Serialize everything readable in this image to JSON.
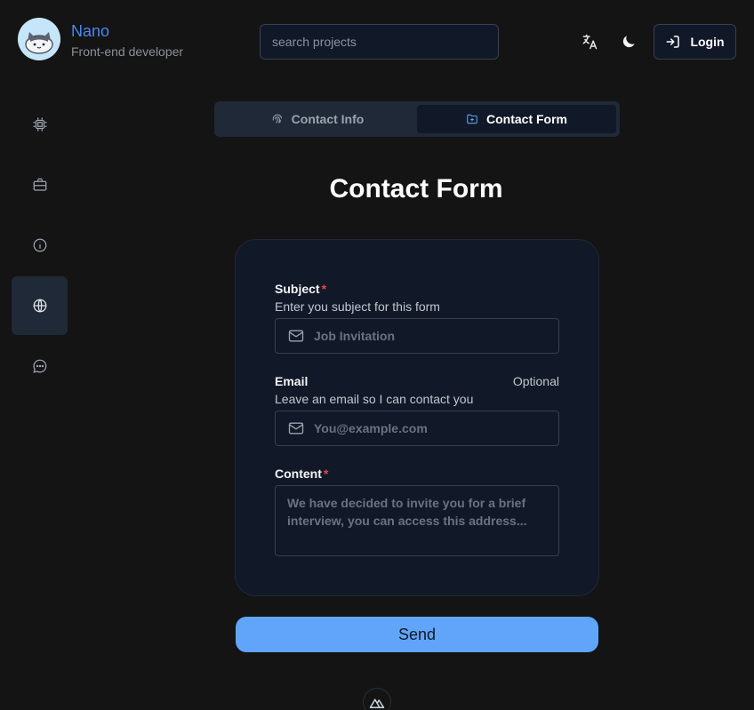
{
  "profile": {
    "name": "Nano",
    "role": "Front-end developer"
  },
  "search": {
    "placeholder": "search projects",
    "value": ""
  },
  "header": {
    "login_label": "Login"
  },
  "sidebar": {
    "items": [
      {
        "icon": "cpu-icon",
        "active": false
      },
      {
        "icon": "briefcase-icon",
        "active": false
      },
      {
        "icon": "info-icon",
        "active": false
      },
      {
        "icon": "globe-icon",
        "active": true
      },
      {
        "icon": "chat-icon",
        "active": false
      }
    ]
  },
  "tabs": [
    {
      "label": "Contact Info",
      "icon": "fingerprint-icon",
      "active": false
    },
    {
      "label": "Contact Form",
      "icon": "folder-icon",
      "active": true
    }
  ],
  "page_title": "Contact Form",
  "form": {
    "subject": {
      "label": "Subject",
      "required_mark": "*",
      "hint": "Enter you subject for this form",
      "placeholder": "Job Invitation",
      "value": ""
    },
    "email": {
      "label": "Email",
      "optional_label": "Optional",
      "hint": "Leave an email so I can contact you",
      "placeholder": "You@example.com",
      "value": ""
    },
    "content": {
      "label": "Content",
      "required_mark": "*",
      "placeholder": "We have decided to invite you for a brief interview, you can access this address...",
      "value": ""
    },
    "send_label": "Send"
  },
  "colors": {
    "accent": "#60a5fa",
    "brand_name": "#4f86f0",
    "required": "#ef4444",
    "background": "#141414",
    "card": "#111827"
  }
}
